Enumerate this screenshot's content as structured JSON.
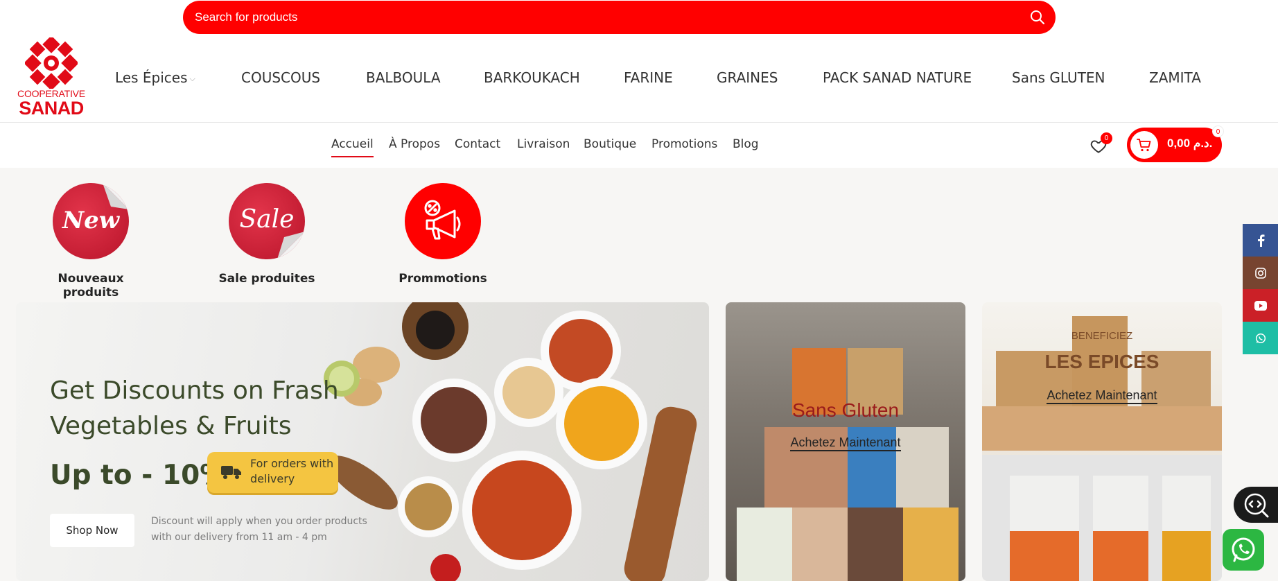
{
  "search": {
    "placeholder": "Search for products"
  },
  "logo": {
    "line1": "COOPERATIVE",
    "line2": "SANAD"
  },
  "category_nav": [
    {
      "label": "Les Épices",
      "has_dropdown": true
    },
    {
      "label": "COUSCOUS"
    },
    {
      "label": "BALBOULA"
    },
    {
      "label": "BARKOUKACH"
    },
    {
      "label": "FARINE"
    },
    {
      "label": "GRAINES"
    },
    {
      "label": "PACK SANAD NATURE"
    },
    {
      "label": "Sans GLUTEN"
    },
    {
      "label": "ZAMITA"
    }
  ],
  "main_nav": [
    {
      "label": "Accueil",
      "active": true
    },
    {
      "label": "À Propos"
    },
    {
      "label": "Contact"
    },
    {
      "label": "Livraison"
    },
    {
      "label": "Boutique"
    },
    {
      "label": "Promotions"
    },
    {
      "label": "Blog"
    }
  ],
  "wishlist": {
    "count": "0",
    "icon": "heart-icon"
  },
  "cart": {
    "total": "0,00 د.م.",
    "count": "0",
    "icon": "cart-icon"
  },
  "promos": [
    {
      "label": "Nouveaux produits",
      "badge_text": "New"
    },
    {
      "label": "Sale produites",
      "badge_text": "Sale"
    },
    {
      "label": "Prommotions",
      "icon": "megaphone-icon"
    }
  ],
  "hero": {
    "title": "Get Discounts on Frash Vegetables & Fruits",
    "discount": "Up to - 10%",
    "pill_text": "For orders with delivery",
    "button": "Shop Now",
    "note": "Discount will apply when you order products with our delivery from 11 am - 4 pm"
  },
  "banners": [
    {
      "title": "Sans Gluten",
      "link": "Achetez Maintenant"
    },
    {
      "pre": "BENEFICIEZ",
      "title": "LES EPICES",
      "link": "Achetez Maintenant"
    }
  ],
  "social": [
    {
      "icon": "facebook-icon",
      "color": "#365493"
    },
    {
      "icon": "instagram-icon",
      "color": "#774430"
    },
    {
      "icon": "youtube-icon",
      "color": "#cb2027"
    },
    {
      "icon": "whatsapp-icon",
      "color": "#1ebea5"
    }
  ],
  "colors": {
    "brand_red": "#ff0000",
    "logo_red": "#e10a17",
    "hero_green": "#3b4a2a",
    "pill_yellow": "#f4c541"
  }
}
